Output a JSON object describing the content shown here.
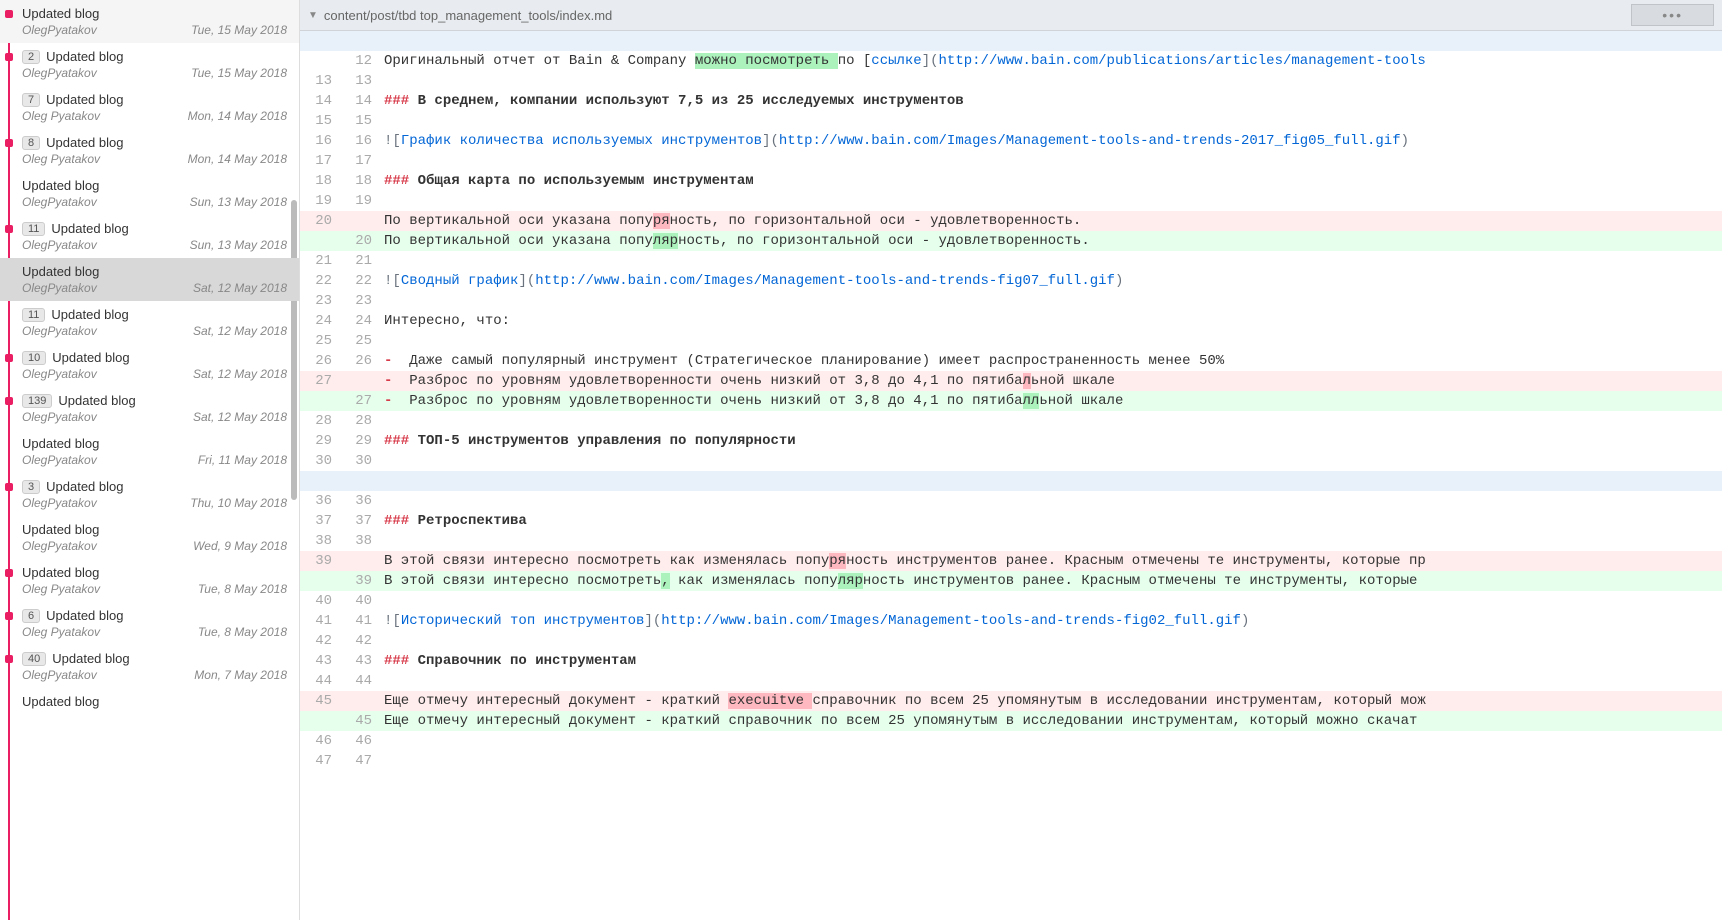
{
  "file_path": "content/post/tbd top_management_tools/index.md",
  "menu_btn": "•••",
  "commits": [
    {
      "badge": "",
      "title": "Updated blog",
      "author": "OlegPyatakov",
      "date": "Tue, 15 May 2018",
      "dot": true
    },
    {
      "badge": "2",
      "title": "Updated blog",
      "author": "OlegPyatakov",
      "date": "Tue, 15 May 2018",
      "dot": true
    },
    {
      "badge": "7",
      "title": "Updated blog",
      "author": "Oleg Pyatakov",
      "date": "Mon, 14 May 2018",
      "dot": false
    },
    {
      "badge": "8",
      "title": "Updated blog",
      "author": "Oleg Pyatakov",
      "date": "Mon, 14 May 2018",
      "dot": true
    },
    {
      "badge": "",
      "title": "Updated blog",
      "author": "OlegPyatakov",
      "date": "Sun, 13 May 2018",
      "dot": false
    },
    {
      "badge": "11",
      "title": "Updated blog",
      "author": "OlegPyatakov",
      "date": "Sun, 13 May 2018",
      "dot": true
    },
    {
      "badge": "",
      "title": "Updated blog",
      "author": "OlegPyatakov",
      "date": "Sat, 12 May 2018",
      "dot": false,
      "selected": true
    },
    {
      "badge": "11",
      "title": "Updated blog",
      "author": "OlegPyatakov",
      "date": "Sat, 12 May 2018",
      "dot": false
    },
    {
      "badge": "10",
      "title": "Updated blog",
      "author": "OlegPyatakov",
      "date": "Sat, 12 May 2018",
      "dot": true
    },
    {
      "badge": "139",
      "title": "Updated blog",
      "author": "OlegPyatakov",
      "date": "Sat, 12 May 2018",
      "dot": true
    },
    {
      "badge": "",
      "title": "Updated blog",
      "author": "OlegPyatakov",
      "date": "Fri, 11 May 2018",
      "dot": false
    },
    {
      "badge": "3",
      "title": "Updated blog",
      "author": "OlegPyatakov",
      "date": "Thu, 10 May 2018",
      "dot": true
    },
    {
      "badge": "",
      "title": "Updated blog",
      "author": "OlegPyatakov",
      "date": "Wed, 9 May 2018",
      "dot": false
    },
    {
      "badge": "",
      "title": "Updated blog",
      "author": "Oleg Pyatakov",
      "date": "Tue, 8 May 2018",
      "dot": true
    },
    {
      "badge": "6",
      "title": "Updated blog",
      "author": "Oleg Pyatakov",
      "date": "Tue, 8 May 2018",
      "dot": true
    },
    {
      "badge": "40",
      "title": "Updated blog",
      "author": "OlegPyatakov",
      "date": "Mon, 7 May 2018",
      "dot": true
    },
    {
      "badge": "",
      "title": "Updated blog",
      "author": "",
      "date": "",
      "dot": false
    }
  ],
  "diff": [
    {
      "type": "hunk",
      "old": "",
      "new": "",
      "text": ""
    },
    {
      "type": "ctx",
      "old": "",
      "new": "12",
      "segs": [
        {
          "t": "Оригинальный отчет от Bain & Company ",
          "c": ""
        },
        {
          "t": "можно посмотреть ",
          "c": "word-add"
        },
        {
          "t": "по [",
          "c": ""
        },
        {
          "t": "ссылке",
          "c": "tok-blue"
        },
        {
          "t": "](",
          "c": "tok-gray"
        },
        {
          "t": "http://www.bain.com/publications/articles/management-tools",
          "c": "tok-blue"
        }
      ]
    },
    {
      "type": "ctx",
      "old": "13",
      "new": "13",
      "segs": [
        {
          "t": "",
          "c": ""
        }
      ]
    },
    {
      "type": "ctx",
      "old": "14",
      "new": "14",
      "segs": [
        {
          "t": "### ",
          "c": "tok-red"
        },
        {
          "t": "В среднем, компании используют 7,5 из 25 исследуемых инструментов",
          "c": "tok-bold"
        }
      ]
    },
    {
      "type": "ctx",
      "old": "15",
      "new": "15",
      "segs": [
        {
          "t": "",
          "c": ""
        }
      ]
    },
    {
      "type": "ctx",
      "old": "16",
      "new": "16",
      "segs": [
        {
          "t": "![",
          "c": "tok-gray"
        },
        {
          "t": "График количества используемых инструментов",
          "c": "tok-blue"
        },
        {
          "t": "](",
          "c": "tok-gray"
        },
        {
          "t": "http://www.bain.com/Images/Management-tools-and-trends-2017_fig05_full.gif",
          "c": "tok-blue"
        },
        {
          "t": ")",
          "c": "tok-gray"
        }
      ]
    },
    {
      "type": "ctx",
      "old": "17",
      "new": "17",
      "segs": [
        {
          "t": "",
          "c": ""
        }
      ]
    },
    {
      "type": "ctx",
      "old": "18",
      "new": "18",
      "segs": [
        {
          "t": "### ",
          "c": "tok-red"
        },
        {
          "t": "Общая карта по используемым инструментам",
          "c": "tok-bold"
        }
      ]
    },
    {
      "type": "ctx",
      "old": "19",
      "new": "19",
      "segs": [
        {
          "t": "",
          "c": ""
        }
      ]
    },
    {
      "type": "del",
      "old": "20",
      "new": "",
      "segs": [
        {
          "t": "По вертикальной оси указана попу",
          "c": ""
        },
        {
          "t": "ря",
          "c": "word-del"
        },
        {
          "t": "ность, по горизонтальной оси - удовлетворенность.",
          "c": ""
        }
      ]
    },
    {
      "type": "add",
      "old": "",
      "new": "20",
      "segs": [
        {
          "t": "По вертикальной оси указана попу",
          "c": ""
        },
        {
          "t": "ляр",
          "c": "word-add"
        },
        {
          "t": "ность, по горизонтальной оси - удовлетворенность.",
          "c": ""
        }
      ]
    },
    {
      "type": "ctx",
      "old": "21",
      "new": "21",
      "segs": [
        {
          "t": "",
          "c": ""
        }
      ]
    },
    {
      "type": "ctx",
      "old": "22",
      "new": "22",
      "segs": [
        {
          "t": "![",
          "c": "tok-gray"
        },
        {
          "t": "Сводный график",
          "c": "tok-blue"
        },
        {
          "t": "](",
          "c": "tok-gray"
        },
        {
          "t": "http://www.bain.com/Images/Management-tools-and-trends-fig07_full.gif",
          "c": "tok-blue"
        },
        {
          "t": ")",
          "c": "tok-gray"
        }
      ]
    },
    {
      "type": "ctx",
      "old": "23",
      "new": "23",
      "segs": [
        {
          "t": "",
          "c": ""
        }
      ]
    },
    {
      "type": "ctx",
      "old": "24",
      "new": "24",
      "segs": [
        {
          "t": "Интересно, что:",
          "c": ""
        }
      ]
    },
    {
      "type": "ctx",
      "old": "25",
      "new": "25",
      "segs": [
        {
          "t": "",
          "c": ""
        }
      ]
    },
    {
      "type": "ctx",
      "old": "26",
      "new": "26",
      "segs": [
        {
          "t": "- ",
          "c": "tok-red"
        },
        {
          "t": " Даже самый популярный инструмент (Стратегическое планирование) имеет распространенность менее 50%",
          "c": ""
        }
      ]
    },
    {
      "type": "del",
      "old": "27",
      "new": "",
      "segs": [
        {
          "t": "- ",
          "c": "tok-red"
        },
        {
          "t": " Разброс по уровням удовлетворенности очень низкий от 3,8 до 4,1 по пятиба",
          "c": ""
        },
        {
          "t": "л",
          "c": "word-del"
        },
        {
          "t": "ьной шкале",
          "c": ""
        }
      ]
    },
    {
      "type": "add",
      "old": "",
      "new": "27",
      "segs": [
        {
          "t": "- ",
          "c": "tok-red"
        },
        {
          "t": " Разброс по уровням удовлетворенности очень низкий от 3,8 до 4,1 по пятиба",
          "c": ""
        },
        {
          "t": "лл",
          "c": "word-add"
        },
        {
          "t": "ьной шкале",
          "c": ""
        }
      ]
    },
    {
      "type": "ctx",
      "old": "28",
      "new": "28",
      "segs": [
        {
          "t": "",
          "c": ""
        }
      ]
    },
    {
      "type": "ctx",
      "old": "29",
      "new": "29",
      "segs": [
        {
          "t": "### ",
          "c": "tok-red"
        },
        {
          "t": "ТОП-5 инструментов управления по популярности",
          "c": "tok-bold"
        }
      ]
    },
    {
      "type": "ctx",
      "old": "30",
      "new": "30",
      "segs": [
        {
          "t": "",
          "c": ""
        }
      ]
    },
    {
      "type": "hunk",
      "old": "",
      "new": "",
      "text": ""
    },
    {
      "type": "ctx",
      "old": "36",
      "new": "36",
      "segs": [
        {
          "t": "",
          "c": ""
        }
      ]
    },
    {
      "type": "ctx",
      "old": "37",
      "new": "37",
      "segs": [
        {
          "t": "### ",
          "c": "tok-red"
        },
        {
          "t": "Ретроспектива",
          "c": "tok-bold"
        }
      ]
    },
    {
      "type": "ctx",
      "old": "38",
      "new": "38",
      "segs": [
        {
          "t": "",
          "c": ""
        }
      ]
    },
    {
      "type": "del",
      "old": "39",
      "new": "",
      "segs": [
        {
          "t": "В этой связи интересно посмотреть как изменялась попу",
          "c": ""
        },
        {
          "t": "ря",
          "c": "word-del"
        },
        {
          "t": "ность инструментов ранее. Красным отмечены те инструменты, которые пр",
          "c": ""
        }
      ]
    },
    {
      "type": "add",
      "old": "",
      "new": "39",
      "segs": [
        {
          "t": "В этой связи интересно посмотреть",
          "c": ""
        },
        {
          "t": ",",
          "c": "word-add"
        },
        {
          "t": " как изменялась попу",
          "c": ""
        },
        {
          "t": "ляр",
          "c": "word-add"
        },
        {
          "t": "ность инструментов ранее. Красным отмечены те инструменты, которые",
          "c": ""
        }
      ]
    },
    {
      "type": "ctx",
      "old": "40",
      "new": "40",
      "segs": [
        {
          "t": "",
          "c": ""
        }
      ]
    },
    {
      "type": "ctx",
      "old": "41",
      "new": "41",
      "segs": [
        {
          "t": "![",
          "c": "tok-gray"
        },
        {
          "t": "Исторический топ инструментов",
          "c": "tok-blue"
        },
        {
          "t": "](",
          "c": "tok-gray"
        },
        {
          "t": "http://www.bain.com/Images/Management-tools-and-trends-fig02_full.gif",
          "c": "tok-blue"
        },
        {
          "t": ")",
          "c": "tok-gray"
        }
      ]
    },
    {
      "type": "ctx",
      "old": "42",
      "new": "42",
      "segs": [
        {
          "t": "",
          "c": ""
        }
      ]
    },
    {
      "type": "ctx",
      "old": "43",
      "new": "43",
      "segs": [
        {
          "t": "### ",
          "c": "tok-red"
        },
        {
          "t": "Справочник по инструментам",
          "c": "tok-bold"
        }
      ]
    },
    {
      "type": "ctx",
      "old": "44",
      "new": "44",
      "segs": [
        {
          "t": "",
          "c": ""
        }
      ]
    },
    {
      "type": "del",
      "old": "45",
      "new": "",
      "segs": [
        {
          "t": "Еще отмечу интересный документ - краткий ",
          "c": ""
        },
        {
          "t": "execuitve ",
          "c": "word-del"
        },
        {
          "t": "справочник по всем 25 упомянутым в исследовании инструментам, который мож",
          "c": ""
        }
      ]
    },
    {
      "type": "add",
      "old": "",
      "new": "45",
      "segs": [
        {
          "t": "Еще отмечу интересный документ - краткий справочник по всем 25 упомянутым в исследовании инструментам, который можно скачат",
          "c": ""
        }
      ]
    },
    {
      "type": "ctx",
      "old": "46",
      "new": "46",
      "segs": [
        {
          "t": "",
          "c": ""
        }
      ]
    },
    {
      "type": "ctx",
      "old": "47",
      "new": "47",
      "segs": [
        {
          "t": "",
          "c": ""
        }
      ]
    }
  ]
}
